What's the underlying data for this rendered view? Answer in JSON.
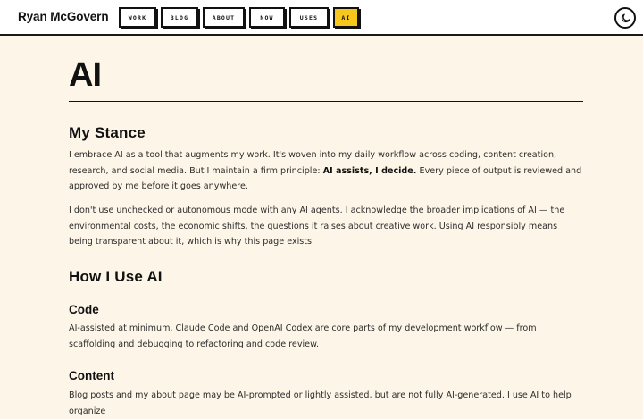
{
  "header": {
    "site_name": "Ryan McGovern",
    "nav": [
      {
        "label": "WORK",
        "active": false
      },
      {
        "label": "BLOG",
        "active": false
      },
      {
        "label": "ABOUT",
        "active": false
      },
      {
        "label": "NOW",
        "active": false
      },
      {
        "label": "USES",
        "active": false
      },
      {
        "label": "AI",
        "active": true
      }
    ],
    "theme_toggle_icon": "moon-icon"
  },
  "page": {
    "title": "AI",
    "stance": {
      "heading": "My Stance",
      "p1_before": "I embrace AI as a tool that augments my work. It's woven into my daily workflow across coding, content creation, research, and social media. But I maintain a firm principle: ",
      "p1_bold": "AI assists, I decide.",
      "p1_after": " Every piece of output is reviewed and approved by me before it goes anywhere.",
      "p2": "I don't use unchecked or autonomous mode with any AI agents. I acknowledge the broader implications of AI — the environmental costs, the economic shifts, the questions it raises about creative work. Using AI responsibly means being transparent about it, which is why this page exists."
    },
    "how": {
      "heading": "How I Use AI",
      "code_heading": "Code",
      "code_text": "AI-assisted at minimum. Claude Code and OpenAI Codex are core parts of my development workflow — from scaffolding and debugging to refactoring and code review.",
      "content_heading": "Content",
      "content_text": "Blog posts and my about page may be AI-prompted or lightly assisted, but are not fully AI-generated. I use AI to help organize"
    }
  },
  "colors": {
    "background": "#fdf6e8",
    "header_bg": "#ffffff",
    "accent_active": "#f8c71c",
    "text": "#1a1a1a"
  }
}
